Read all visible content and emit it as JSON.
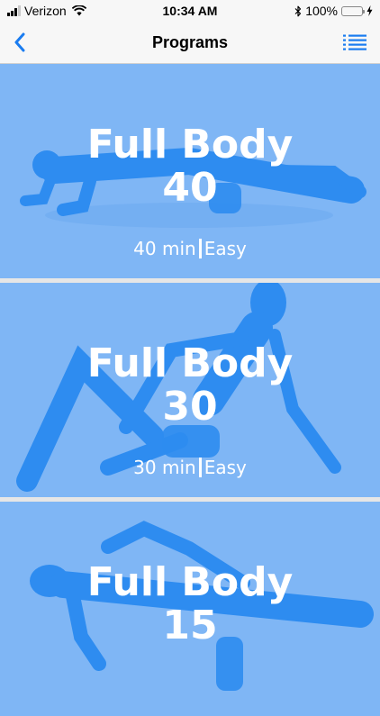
{
  "status_bar": {
    "carrier": "Verizon",
    "time": "10:34 AM",
    "battery": "100%",
    "icons": [
      "signal-icon",
      "wifi-icon",
      "bluetooth-icon",
      "battery-icon",
      "charging-icon"
    ]
  },
  "nav": {
    "title": "Programs",
    "back_icon": "chevron-left-icon",
    "menu_icon": "list-icon"
  },
  "colors": {
    "accent": "#1a7cf0",
    "card_background": "#7fb6f5",
    "figure": "#2e8cf0"
  },
  "programs": [
    {
      "name": "Full Body",
      "number": "40",
      "duration": "40 min",
      "difficulty": "Easy"
    },
    {
      "name": "Full Body",
      "number": "30",
      "duration": "30 min",
      "difficulty": "Easy"
    },
    {
      "name": "Full Body",
      "number": "15"
    }
  ]
}
